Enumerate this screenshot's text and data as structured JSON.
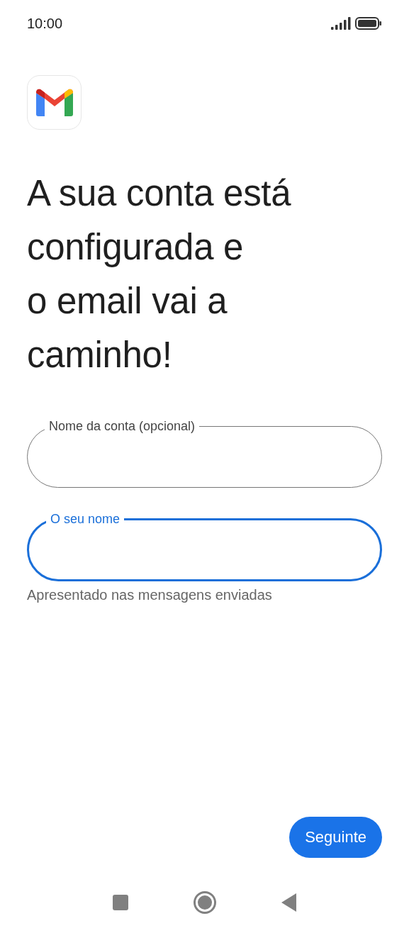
{
  "status_bar": {
    "time": "10:00"
  },
  "title_lines": [
    "A sua conta está",
    "configurada e",
    "o email vai a",
    "caminho!"
  ],
  "fields": [
    {
      "label": "Nome da conta (opcional)",
      "focused": false
    },
    {
      "label": "O seu nome",
      "focused": true,
      "helper": "Apresentado nas mensagens enviadas"
    }
  ],
  "next_button": "Seguinte"
}
